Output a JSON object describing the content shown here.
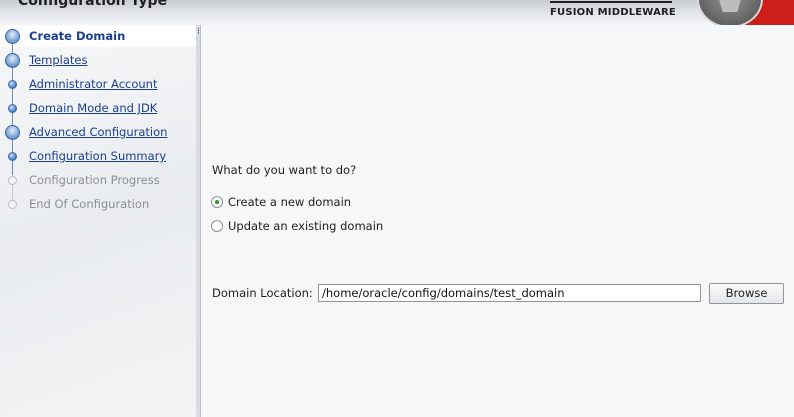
{
  "header": {
    "title": "Configuration Type",
    "brand": "FUSION MIDDLEWARE",
    "logo_icon": "oracle-fusion-logo",
    "colors": {
      "logo_red": "#cc1f1a",
      "nav_link": "#1a3f8f",
      "disabled": "#8a8f95"
    }
  },
  "nav": {
    "items": [
      {
        "label": "Create Domain",
        "state": "current"
      },
      {
        "label": "Templates",
        "state": "link"
      },
      {
        "label": "Administrator Account",
        "state": "link"
      },
      {
        "label": "Domain Mode and JDK",
        "state": "link"
      },
      {
        "label": "Advanced Configuration",
        "state": "link"
      },
      {
        "label": "Configuration Summary",
        "state": "link"
      },
      {
        "label": "Configuration Progress",
        "state": "disabled"
      },
      {
        "label": "End Of Configuration",
        "state": "disabled"
      }
    ]
  },
  "main": {
    "question": "What do you want to do?",
    "options": [
      {
        "label": "Create a new domain",
        "checked": true
      },
      {
        "label": "Update an existing domain",
        "checked": false
      }
    ],
    "location_label": "Domain Location:",
    "location_value": "/home/oracle/config/domains/test_domain",
    "browse_label": "Browse"
  }
}
